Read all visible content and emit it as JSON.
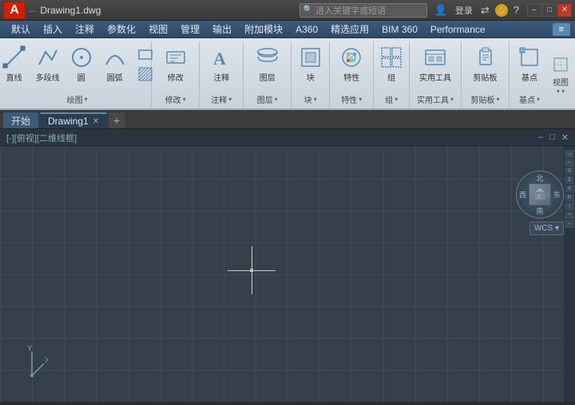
{
  "titlebar": {
    "app_letter": "A",
    "dots": "...",
    "filename": "Drawing1.dwg",
    "search_placeholder": "进入关键字或短语",
    "icons": [
      "👤",
      "登录",
      "?"
    ],
    "window_controls": [
      "–",
      "□",
      "✕"
    ]
  },
  "menubar": {
    "items": [
      "默认",
      "插入",
      "注释",
      "参数化",
      "视图",
      "管理",
      "输出",
      "附加模块",
      "A360",
      "精选应用",
      "BIM 360",
      "Performance"
    ],
    "right_btn": "≡"
  },
  "ribbon": {
    "groups": [
      {
        "label": "绘图",
        "tools_row1": [
          "直线",
          "多段线",
          "圆",
          "圆弧"
        ],
        "tools_row2": []
      },
      {
        "label": "修改",
        "tools": [
          "修改"
        ]
      },
      {
        "label": "注释",
        "tools": [
          "注释"
        ]
      },
      {
        "label": "图层",
        "tools": [
          "图层"
        ]
      },
      {
        "label": "块",
        "tools": [
          "块"
        ]
      },
      {
        "label": "特性",
        "tools": [
          "特性"
        ]
      },
      {
        "label": "组",
        "tools": [
          "组"
        ]
      },
      {
        "label": "实用工具",
        "tools": [
          "实用工具"
        ]
      },
      {
        "label": "剪贴板",
        "tools": [
          "剪贴板"
        ]
      },
      {
        "label": "基点",
        "tools": [
          "基点"
        ]
      }
    ]
  },
  "tabs": {
    "items": [
      {
        "label": "开始",
        "active": false,
        "closeable": false
      },
      {
        "label": "Drawing1",
        "active": true,
        "closeable": true
      }
    ],
    "add_label": "+"
  },
  "canvas": {
    "header_label": "[-][俯视][二维线框]",
    "header_btns": [
      "–",
      "□",
      "✕"
    ],
    "wcs_label": "WCS ▾",
    "compass": {
      "N": "北",
      "S": "南",
      "E": "东",
      "W": "西"
    }
  },
  "axis": {
    "x_label": "X",
    "y_label": "Y"
  }
}
